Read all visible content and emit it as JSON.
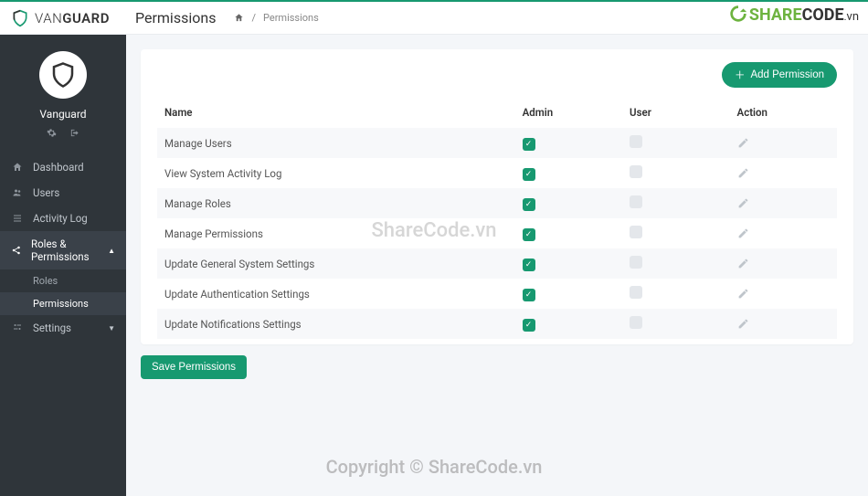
{
  "brand": {
    "name_light": "VAN",
    "name_bold": "GUARD"
  },
  "header": {
    "title": "Permissions",
    "breadcrumb_sep": "/",
    "breadcrumb_current": "Permissions"
  },
  "sharecode_badge": {
    "prefix": "SHARE",
    "suffix": "CODE",
    "tld": "vn"
  },
  "sidebar": {
    "username": "Vanguard",
    "items": [
      {
        "label": "Dashboard"
      },
      {
        "label": "Users"
      },
      {
        "label": "Activity Log"
      },
      {
        "label": "Roles & Permissions"
      },
      {
        "label": "Settings"
      }
    ],
    "sub_roles_permissions": [
      {
        "label": "Roles"
      },
      {
        "label": "Permissions"
      }
    ]
  },
  "card": {
    "add_button": "Add Permission",
    "columns": {
      "name": "Name",
      "admin": "Admin",
      "user": "User",
      "action": "Action"
    },
    "rows": [
      {
        "name": "Manage Users",
        "admin": true,
        "user": false
      },
      {
        "name": "View System Activity Log",
        "admin": true,
        "user": false
      },
      {
        "name": "Manage Roles",
        "admin": true,
        "user": false
      },
      {
        "name": "Manage Permissions",
        "admin": true,
        "user": false
      },
      {
        "name": "Update General System Settings",
        "admin": true,
        "user": false
      },
      {
        "name": "Update Authentication Settings",
        "admin": true,
        "user": false
      },
      {
        "name": "Update Notifications Settings",
        "admin": true,
        "user": false
      }
    ],
    "save_button": "Save Permissions"
  },
  "watermarks": {
    "center": "ShareCode.vn",
    "bottom": "Copyright © ShareCode.vn"
  },
  "colors": {
    "accent": "#179970",
    "sidebar": "#2f353a"
  }
}
